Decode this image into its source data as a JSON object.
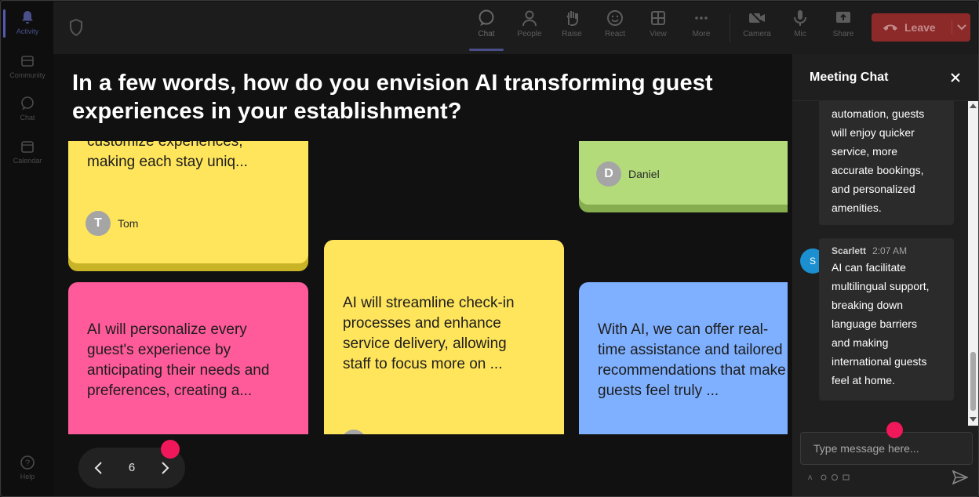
{
  "rail": {
    "items": [
      {
        "label": "Activity",
        "icon": "bell-icon"
      },
      {
        "label": "Community",
        "icon": "community-icon"
      },
      {
        "label": "Chat",
        "icon": "chat-icon"
      },
      {
        "label": "Calendar",
        "icon": "calendar-icon"
      }
    ],
    "help_label": "Help"
  },
  "toolbar": {
    "items": [
      {
        "label": "Chat",
        "icon": "chat-icon"
      },
      {
        "label": "People",
        "icon": "people-icon"
      },
      {
        "label": "Raise",
        "icon": "raise-hand-icon"
      },
      {
        "label": "React",
        "icon": "smile-icon"
      },
      {
        "label": "View",
        "icon": "grid-icon"
      },
      {
        "label": "More",
        "icon": "more-icon"
      },
      {
        "label": "Camera",
        "icon": "camera-off-icon"
      },
      {
        "label": "Mic",
        "icon": "mic-icon"
      },
      {
        "label": "Share",
        "icon": "share-icon"
      }
    ],
    "leave_label": "Leave",
    "leave_color": "#c4314b"
  },
  "question": "In a few words, how do you envision AI transforming guest experiences in your establishment?",
  "notes": [
    {
      "text": "customize experiences, making each stay uniq...",
      "author": "Tom",
      "initial": "T",
      "color": "#ffe55c"
    },
    {
      "text": "",
      "author": "Daniel",
      "initial": "D",
      "color": "#b3db7a"
    },
    {
      "text": "AI will personalize every guest's experience by anticipating their needs and preferences, creating a...",
      "author": "",
      "initial": "",
      "color": "#ff5a9a"
    },
    {
      "text": "AI will streamline check-in processes and enhance service delivery, allowing staff to focus more on ...",
      "author": "",
      "initial": "",
      "color": "#ffe55c"
    },
    {
      "text": "With AI, we can offer real-time assistance and tailored recommendations that make guests feel truly ...",
      "author": "",
      "initial": "",
      "color": "#7fb0ff"
    }
  ],
  "pager": {
    "page": "6"
  },
  "chat": {
    "title": "Meeting Chat",
    "messages": [
      {
        "text": [
          "automation, guests",
          "will enjoy quicker",
          "service, more",
          "accurate bookings,",
          "and personalized",
          "amenities."
        ]
      },
      {
        "sender": "Scarlett",
        "time": "2:07 AM",
        "avatar": "S",
        "text": [
          "AI can facilitate",
          "multilingual support,",
          "breaking down",
          "language barriers",
          "and making",
          "international guests",
          "feel at home."
        ]
      }
    ],
    "input_placeholder": "Type message here..."
  }
}
